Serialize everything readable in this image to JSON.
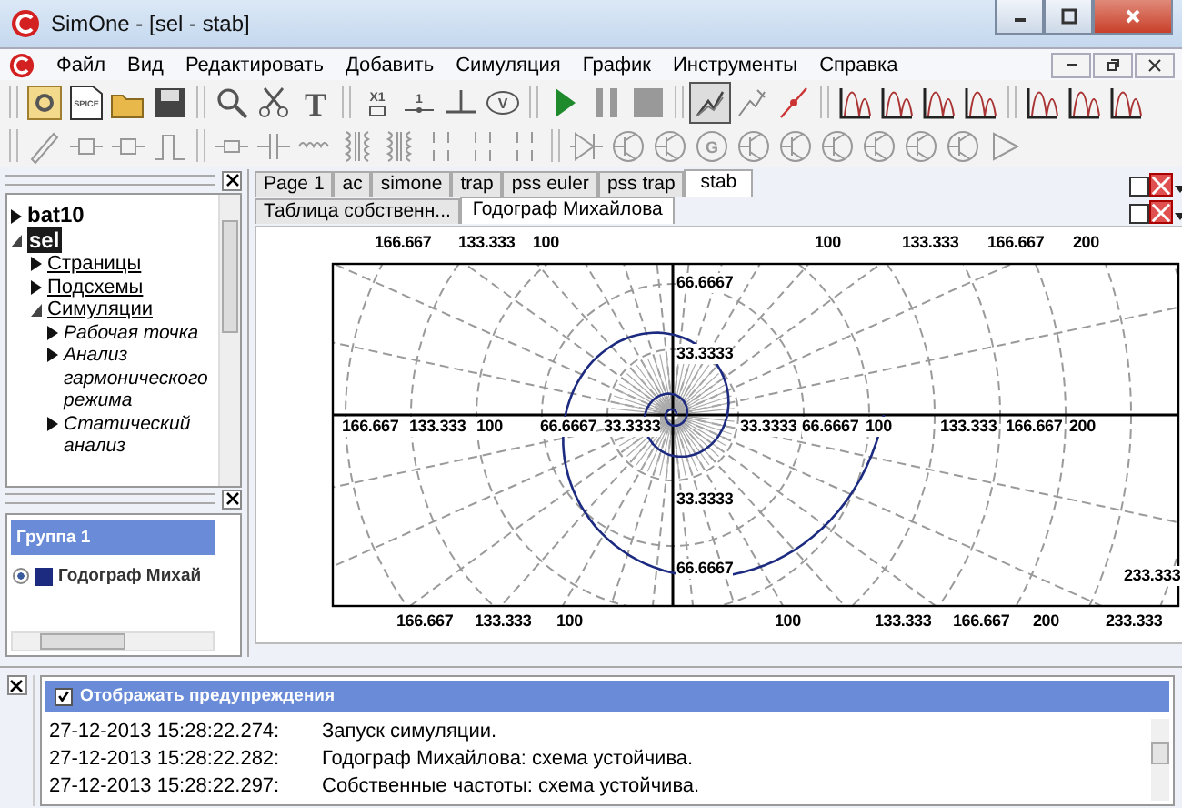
{
  "window": {
    "title": "SimOne - [sel - stab]"
  },
  "menu": [
    "Файл",
    "Вид",
    "Редактировать",
    "Добавить",
    "Симуляция",
    "График",
    "Инструменты",
    "Справка"
  ],
  "toolbar_1": [
    [
      {
        "kind": "schematic",
        "pressed": false
      },
      {
        "kind": "spice",
        "label": "SPICE",
        "pressed": false
      },
      {
        "kind": "open",
        "pressed": false
      },
      {
        "kind": "save",
        "pressed": false
      }
    ],
    [
      {
        "kind": "search",
        "pressed": false
      },
      {
        "kind": "scissors",
        "pressed": false
      },
      {
        "kind": "text",
        "label": "T",
        "pressed": false
      }
    ],
    [
      {
        "kind": "subcircuit",
        "label": "X1",
        "pressed": false
      },
      {
        "kind": "node",
        "label": "1",
        "pressed": false
      },
      {
        "kind": "ground",
        "pressed": false
      },
      {
        "kind": "voltmeter",
        "label": "V",
        "pressed": false
      }
    ],
    [
      {
        "kind": "play",
        "pressed": false
      },
      {
        "kind": "pause",
        "pressed": false
      },
      {
        "kind": "stop",
        "pressed": false
      }
    ],
    [
      {
        "kind": "graph",
        "pressed": true
      },
      {
        "kind": "probe",
        "pressed": false
      },
      {
        "kind": "marker",
        "pressed": false
      }
    ],
    [
      {
        "kind": "plot",
        "pressed": false
      },
      {
        "kind": "plot",
        "pressed": false
      },
      {
        "kind": "plot",
        "pressed": false
      },
      {
        "kind": "plot",
        "pressed": false
      }
    ],
    [
      {
        "kind": "plot",
        "pressed": false
      },
      {
        "kind": "plot",
        "pressed": false
      },
      {
        "kind": "plot",
        "pressed": false
      }
    ]
  ],
  "toolbar_2": [
    [
      {
        "kind": "pencil"
      },
      {
        "kind": "block"
      },
      {
        "kind": "block"
      },
      {
        "kind": "pulse"
      }
    ],
    [
      {
        "kind": "resistor"
      },
      {
        "kind": "capacitor"
      },
      {
        "kind": "inductor"
      },
      {
        "kind": "transformer"
      },
      {
        "kind": "transformer"
      },
      {
        "kind": "switch"
      },
      {
        "kind": "switch"
      },
      {
        "kind": "switch"
      }
    ],
    [
      {
        "kind": "diode"
      },
      {
        "kind": "transistor"
      },
      {
        "kind": "transistor"
      },
      {
        "kind": "source",
        "label": "G"
      },
      {
        "kind": "transistor"
      },
      {
        "kind": "transistor"
      },
      {
        "kind": "transistor"
      },
      {
        "kind": "transistor"
      },
      {
        "kind": "transistor"
      },
      {
        "kind": "transistor"
      },
      {
        "kind": "amplifier"
      }
    ]
  ],
  "tree": [
    {
      "label": "bat10",
      "expanded": false,
      "selected": false
    },
    {
      "label": "sel",
      "expanded": true,
      "selected": true,
      "children": [
        {
          "label": "Страницы",
          "expanded": false,
          "selected": false
        },
        {
          "label": "Подсхемы",
          "expanded": false,
          "selected": false
        },
        {
          "label": "Симуляции",
          "expanded": true,
          "selected": false,
          "children": [
            {
              "label": "Рабочая точка",
              "expanded": false,
              "selected": false
            },
            {
              "label": "Анализ гармонического режима",
              "expanded": false,
              "selected": false
            },
            {
              "label": "Статический анализ",
              "expanded": false,
              "selected": false
            }
          ]
        }
      ]
    }
  ],
  "groups": [
    {
      "title": "Группа 1",
      "items": [
        {
          "label": "Годограф Михай",
          "color": "#1c2a80",
          "selected": true
        }
      ]
    }
  ],
  "tabs": [
    {
      "label": "Page 1",
      "selected": false
    },
    {
      "label": "ac",
      "selected": false
    },
    {
      "label": "simone",
      "selected": false
    },
    {
      "label": "trap",
      "selected": false
    },
    {
      "label": "pss euler",
      "selected": false
    },
    {
      "label": "pss trap",
      "selected": false
    },
    {
      "label": "stab",
      "selected": true
    }
  ],
  "subtabs": [
    {
      "label": "Таблица собственн...",
      "selected": false
    },
    {
      "label": "Годограф Михайлова",
      "selected": true
    }
  ],
  "plot": {
    "top_labels": [
      "166.667",
      "133.333",
      "100",
      "100",
      "133.333",
      "166.667",
      "200"
    ],
    "axis_labels": [
      "166.667",
      "133.333",
      "100",
      "66.6667",
      "33.3333",
      "33.3333",
      "66.6667",
      "100",
      "133.333",
      "166.667",
      "200"
    ],
    "vertical_labels": [
      "66.6667",
      "33.3333",
      "33.3333",
      "66.6667"
    ],
    "bottom_labels": [
      "166.667",
      "133.333",
      "100",
      "100",
      "133.333",
      "166.667",
      "200",
      "233.333"
    ],
    "edge_label": "233.333"
  },
  "log": {
    "show_warnings": {
      "label": "Отображать предупреждения",
      "checked": true
    },
    "entries": [
      {
        "time": "27-12-2013 15:28:22.274:",
        "message": "Запуск симуляции."
      },
      {
        "time": "27-12-2013 15:28:22.282:",
        "message": "Годограф Михайлова: схема устойчива."
      },
      {
        "time": "27-12-2013 15:28:22.297:",
        "message": "Собственные частоты: схема устойчива."
      }
    ]
  }
}
